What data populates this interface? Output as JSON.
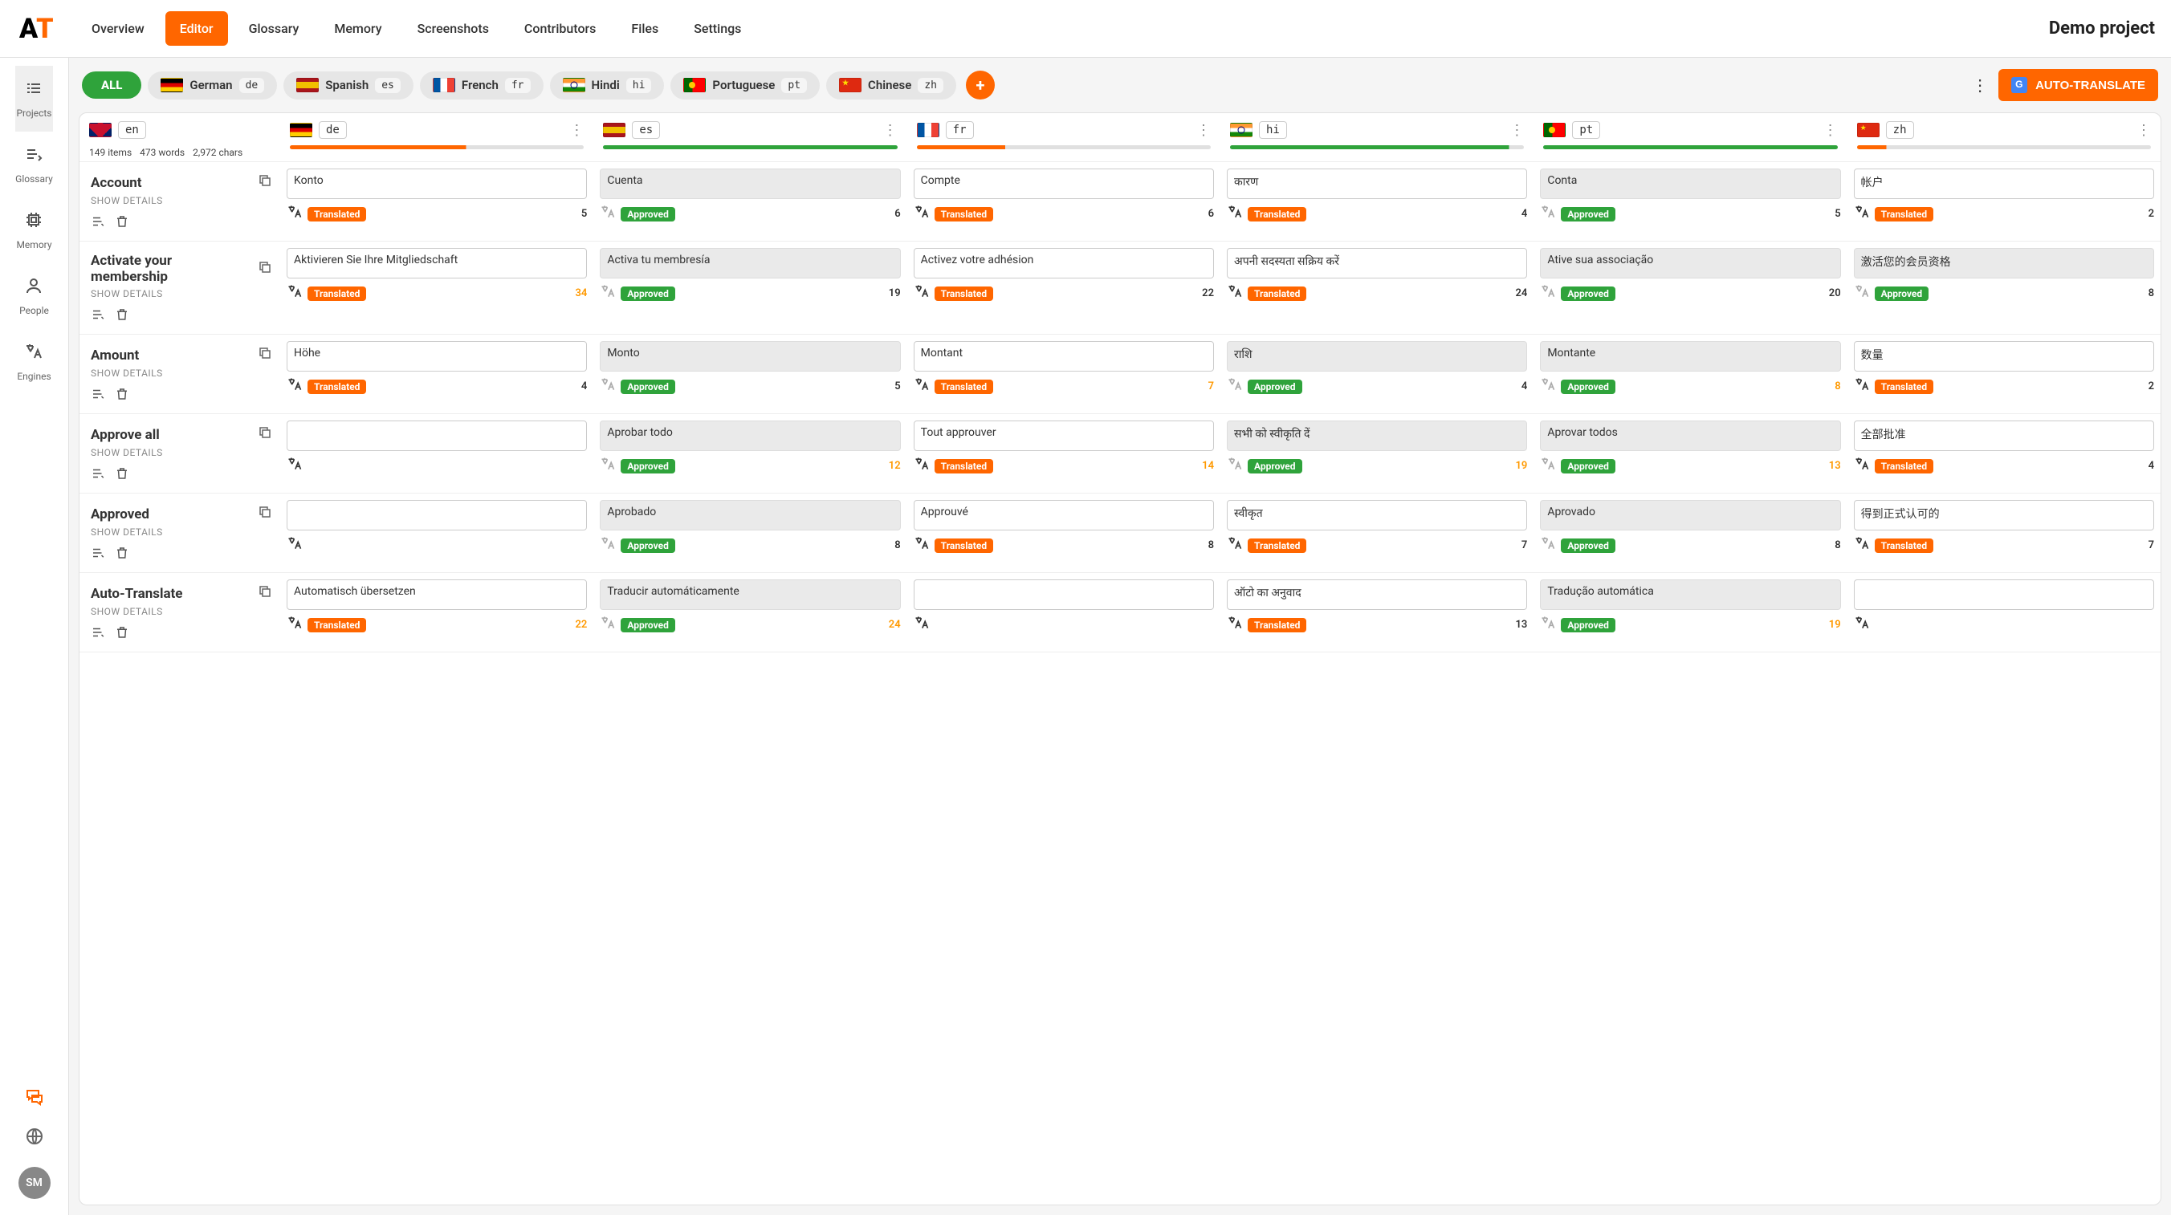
{
  "logo": {
    "a": "A",
    "t": "T"
  },
  "topnav": [
    "Overview",
    "Editor",
    "Glossary",
    "Memory",
    "Screenshots",
    "Contributors",
    "Files",
    "Settings"
  ],
  "topnav_active": 1,
  "project_title": "Demo project",
  "sidebar": {
    "items": [
      {
        "label": "Projects",
        "icon": "list"
      },
      {
        "label": "Glossary",
        "icon": "edit"
      },
      {
        "label": "Memory",
        "icon": "chip"
      },
      {
        "label": "People",
        "icon": "person"
      },
      {
        "label": "Engines",
        "icon": "translate"
      }
    ],
    "active": 0,
    "avatar": "SM"
  },
  "langbar": {
    "all": "ALL",
    "langs": [
      {
        "name": "German",
        "code": "de",
        "flag": "de"
      },
      {
        "name": "Spanish",
        "code": "es",
        "flag": "es"
      },
      {
        "name": "French",
        "code": "fr",
        "flag": "fr"
      },
      {
        "name": "Hindi",
        "code": "hi",
        "flag": "hi"
      },
      {
        "name": "Portuguese",
        "code": "pt",
        "flag": "pt"
      },
      {
        "name": "Chinese",
        "code": "zh",
        "flag": "zh"
      }
    ],
    "auto_translate": "AUTO-TRANSLATE"
  },
  "header": {
    "source": {
      "code": "en",
      "flag": "en",
      "items": "149 items",
      "words": "473 words",
      "chars": "2,972 chars"
    },
    "cols": [
      {
        "code": "de",
        "flag": "de",
        "progress": 60,
        "color": "#ff6600"
      },
      {
        "code": "es",
        "flag": "es",
        "progress": 100,
        "color": "#2fa33b"
      },
      {
        "code": "fr",
        "flag": "fr",
        "progress": 30,
        "color": "#ff6600"
      },
      {
        "code": "hi",
        "flag": "hi",
        "progress": 95,
        "color": "#2fa33b"
      },
      {
        "code": "pt",
        "flag": "pt",
        "progress": 100,
        "color": "#2fa33b"
      },
      {
        "code": "zh",
        "flag": "zh",
        "progress": 10,
        "color": "#ff6600"
      }
    ]
  },
  "rows": [
    {
      "key": "Account",
      "details": "SHOW DETAILS",
      "cells": [
        {
          "text": "Konto",
          "status": "Translated",
          "count": "5",
          "shaded": false
        },
        {
          "text": "Cuenta",
          "status": "Approved",
          "count": "6",
          "shaded": true,
          "gray": true
        },
        {
          "text": "Compte",
          "status": "Translated",
          "count": "6",
          "shaded": false
        },
        {
          "text": "कारण",
          "status": "Translated",
          "count": "4",
          "shaded": false
        },
        {
          "text": "Conta",
          "status": "Approved",
          "count": "5",
          "shaded": true,
          "gray": true
        },
        {
          "text": "帐户",
          "status": "Translated",
          "count": "2",
          "shaded": false
        }
      ]
    },
    {
      "key": "Activate your membership",
      "details": "SHOW DETAILS",
      "cells": [
        {
          "text": "Aktivieren Sie Ihre Mitgliedschaft",
          "status": "Translated",
          "count": "34",
          "shaded": false,
          "count_orange": true
        },
        {
          "text": "Activa tu membresía",
          "status": "Approved",
          "count": "19",
          "shaded": true,
          "gray": true
        },
        {
          "text": "Activez votre adhésion",
          "status": "Translated",
          "count": "22",
          "shaded": false
        },
        {
          "text": "अपनी सदस्यता सक्रिय करें",
          "status": "Translated",
          "count": "24",
          "shaded": false
        },
        {
          "text": "Ative sua associação",
          "status": "Approved",
          "count": "20",
          "shaded": true,
          "gray": true
        },
        {
          "text": "激活您的会员资格",
          "status": "Approved",
          "count": "8",
          "shaded": true,
          "gray": true
        }
      ]
    },
    {
      "key": "Amount",
      "details": "SHOW DETAILS",
      "cells": [
        {
          "text": "Höhe",
          "status": "Translated",
          "count": "4",
          "shaded": false
        },
        {
          "text": "Monto",
          "status": "Approved",
          "count": "5",
          "shaded": true,
          "gray": true
        },
        {
          "text": "Montant",
          "status": "Translated",
          "count": "7",
          "shaded": false,
          "count_orange": true
        },
        {
          "text": "राशि",
          "status": "Approved",
          "count": "4",
          "shaded": true,
          "gray": true
        },
        {
          "text": "Montante",
          "status": "Approved",
          "count": "8",
          "shaded": true,
          "gray": true,
          "count_orange": true
        },
        {
          "text": "数量",
          "status": "Translated",
          "count": "2",
          "shaded": false
        }
      ]
    },
    {
      "key": "Approve all",
      "details": "SHOW DETAILS",
      "cells": [
        {
          "text": "",
          "status": "",
          "count": "",
          "shaded": false
        },
        {
          "text": "Aprobar todo",
          "status": "Approved",
          "count": "12",
          "shaded": true,
          "gray": true,
          "count_orange": true
        },
        {
          "text": "Tout approuver",
          "status": "Translated",
          "count": "14",
          "shaded": false,
          "count_orange": true
        },
        {
          "text": "सभी को स्वीकृति दें",
          "status": "Approved",
          "count": "19",
          "shaded": true,
          "gray": true,
          "count_orange": true
        },
        {
          "text": "Aprovar todos",
          "status": "Approved",
          "count": "13",
          "shaded": true,
          "gray": true,
          "count_orange": true
        },
        {
          "text": "全部批准",
          "status": "Translated",
          "count": "4",
          "shaded": false
        }
      ]
    },
    {
      "key": "Approved",
      "details": "SHOW DETAILS",
      "cells": [
        {
          "text": "",
          "status": "",
          "count": "",
          "shaded": false
        },
        {
          "text": "Aprobado",
          "status": "Approved",
          "count": "8",
          "shaded": true,
          "gray": true
        },
        {
          "text": "Approuvé",
          "status": "Translated",
          "count": "8",
          "shaded": false
        },
        {
          "text": "स्वीकृत",
          "status": "Translated",
          "count": "7",
          "shaded": false
        },
        {
          "text": "Aprovado",
          "status": "Approved",
          "count": "8",
          "shaded": true,
          "gray": true
        },
        {
          "text": "得到正式认可的",
          "status": "Translated",
          "count": "7",
          "shaded": false
        }
      ]
    },
    {
      "key": "Auto-Translate",
      "details": "SHOW DETAILS",
      "cells": [
        {
          "text": "Automatisch übersetzen",
          "status": "Translated",
          "count": "22",
          "shaded": false,
          "count_orange": true
        },
        {
          "text": "Traducir automáticamente",
          "status": "Approved",
          "count": "24",
          "shaded": true,
          "gray": true,
          "count_orange": true
        },
        {
          "text": "",
          "status": "",
          "count": "",
          "shaded": false,
          "icon_only": true
        },
        {
          "text": "ऑटो का अनुवाद",
          "status": "Translated",
          "count": "13",
          "shaded": false
        },
        {
          "text": "Tradução automática",
          "status": "Approved",
          "count": "19",
          "shaded": true,
          "gray": true,
          "count_orange": true
        },
        {
          "text": "",
          "status": "",
          "count": "",
          "shaded": false,
          "icon_only": true
        }
      ]
    }
  ]
}
